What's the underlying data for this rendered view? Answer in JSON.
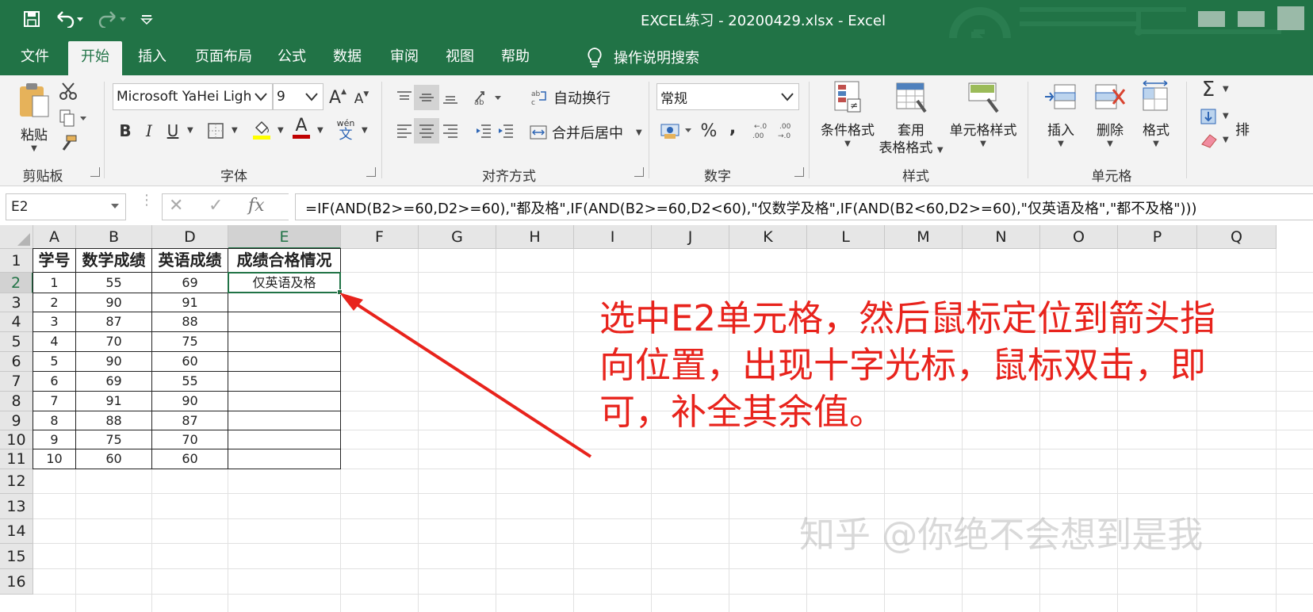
{
  "window": {
    "title": "EXCEL练习 - 20200429.xlsx  -  Excel"
  },
  "quick_access": {
    "save_icon": "save-icon",
    "undo_icon": "undo-icon",
    "redo_icon": "redo-icon",
    "customize_icon": "customize-qat-icon"
  },
  "tabs": [
    {
      "label": "文件"
    },
    {
      "label": "开始"
    },
    {
      "label": "插入"
    },
    {
      "label": "页面布局"
    },
    {
      "label": "公式"
    },
    {
      "label": "数据"
    },
    {
      "label": "审阅"
    },
    {
      "label": "视图"
    },
    {
      "label": "帮助"
    }
  ],
  "tell_me": {
    "label": "操作说明搜索",
    "icon": "lightbulb-icon"
  },
  "ribbon": {
    "clipboard": {
      "paste_label": "粘贴",
      "group_label": "剪贴板"
    },
    "font": {
      "font_name": "Microsoft YaHei Ligh",
      "font_size": "9",
      "bold": "B",
      "italic": "I",
      "underline": "U",
      "font_color_glyph": "A",
      "phonetic_top": "wén",
      "phonetic_bottom": "文",
      "grow_glyph": "A",
      "shrink_glyph": "A",
      "group_label": "字体"
    },
    "alignment": {
      "wrap_text": "自动换行",
      "merge_center": "合并后居中",
      "group_label": "对齐方式"
    },
    "number": {
      "format": "常规",
      "percent": "%",
      "comma": ",",
      "group_label": "数字"
    },
    "styles": {
      "conditional_formatting": "条件格式",
      "format_as_table_line1": "套用",
      "format_as_table_line2": "表格格式",
      "cell_styles": "单元格样式",
      "group_label": "样式"
    },
    "cells": {
      "insert": "插入",
      "delete": "删除",
      "format": "格式",
      "group_label": "单元格"
    },
    "editing": {
      "sum_glyph": "Σ",
      "overflow_char": "排"
    }
  },
  "formula_bar": {
    "name_box": "E2",
    "cancel_glyph": "✕",
    "enter_glyph": "✓",
    "fx_glyph": "fx",
    "formula": "=IF(AND(B2>=60,D2>=60),\"都及格\",IF(AND(B2>=60,D2<60),\"仅数学及格\",IF(AND(B2<60,D2>=60),\"仅英语及格\",\"都不及格\")))"
  },
  "sheet": {
    "column_headers": [
      "A",
      "B",
      "D",
      "E",
      "F",
      "G",
      "H",
      "I",
      "J",
      "K",
      "L",
      "M",
      "N",
      "O",
      "P",
      "Q"
    ],
    "row_headers": [
      "1",
      "2",
      "3",
      "4",
      "5",
      "6",
      "7",
      "8",
      "9",
      "10",
      "11",
      "12",
      "13",
      "14",
      "15",
      "16"
    ],
    "table_headers": [
      "学号",
      "数学成绩",
      "英语成绩",
      "成绩合格情况"
    ],
    "rows": [
      [
        "1",
        "55",
        "69",
        "仅英语及格"
      ],
      [
        "2",
        "90",
        "91",
        ""
      ],
      [
        "3",
        "87",
        "88",
        ""
      ],
      [
        "4",
        "70",
        "75",
        ""
      ],
      [
        "5",
        "90",
        "60",
        ""
      ],
      [
        "6",
        "69",
        "55",
        ""
      ],
      [
        "7",
        "91",
        "90",
        ""
      ],
      [
        "8",
        "88",
        "87",
        ""
      ],
      [
        "9",
        "75",
        "70",
        ""
      ],
      [
        "10",
        "60",
        "60",
        ""
      ]
    ],
    "selected_cell": "E2"
  },
  "annotation": {
    "text": "选中E2单元格，然后鼠标定位到箭头指向位置，出现十字光标，鼠标双击，即可，补全其余值。",
    "color": "#e8231c"
  },
  "watermark": "知乎 @你绝不会想到是我",
  "colors": {
    "excel_green": "#217346",
    "ribbon_bg": "#f3f3f3",
    "arrow_red": "#e8231c"
  }
}
